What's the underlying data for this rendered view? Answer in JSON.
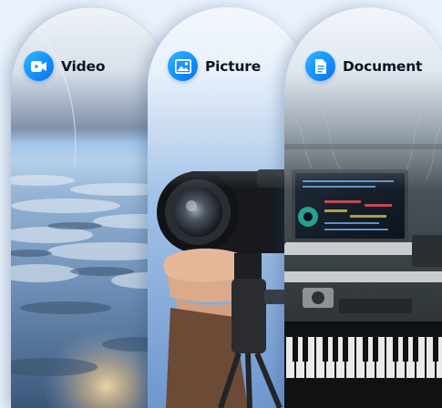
{
  "categories": [
    {
      "id": "video",
      "label": "Video",
      "icon": "video-camera-icon"
    },
    {
      "id": "picture",
      "label": "Picture",
      "icon": "image-icon"
    },
    {
      "id": "document",
      "label": "Document",
      "icon": "document-icon"
    }
  ],
  "colors": {
    "icon_bg": "#1590ff",
    "label": "#0d1422",
    "page_bg": "#e9f1fb"
  }
}
